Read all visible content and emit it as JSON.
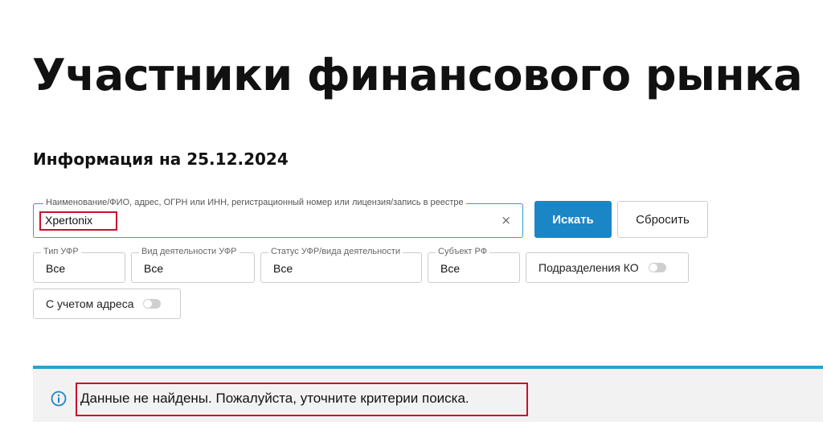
{
  "page": {
    "title": "Участники финансового рынка",
    "info_date": "Информация на 25.12.2024"
  },
  "search": {
    "legend": "Наименование/ФИО, адрес, ОГРН или ИНН, регистрационный номер или лицензия/запись в реестре",
    "value": "Xpertonix",
    "clear_icon": "×",
    "search_label": "Искать",
    "reset_label": "Сбросить"
  },
  "filters": [
    {
      "legend": "Тип УФР",
      "value": "Все"
    },
    {
      "legend": "Вид деятельности УФР",
      "value": "Все"
    },
    {
      "legend": "Статус УФР/вида деятельности",
      "value": "Все"
    },
    {
      "legend": "Субъект РФ",
      "value": "Все"
    }
  ],
  "toggles": {
    "ko_divisions": {
      "label": "Подразделения КО",
      "on": false
    },
    "with_address": {
      "label": "С учетом адреса",
      "on": false
    }
  },
  "alert": {
    "icon": "info-icon",
    "message": "Данные не найдены. Пожалуйста, уточните критерии поиска."
  },
  "colors": {
    "accent": "#2aa1cf",
    "primary_button": "#1b86c6",
    "highlight": "#c8102e",
    "alert_bg": "#f2f2f2"
  }
}
